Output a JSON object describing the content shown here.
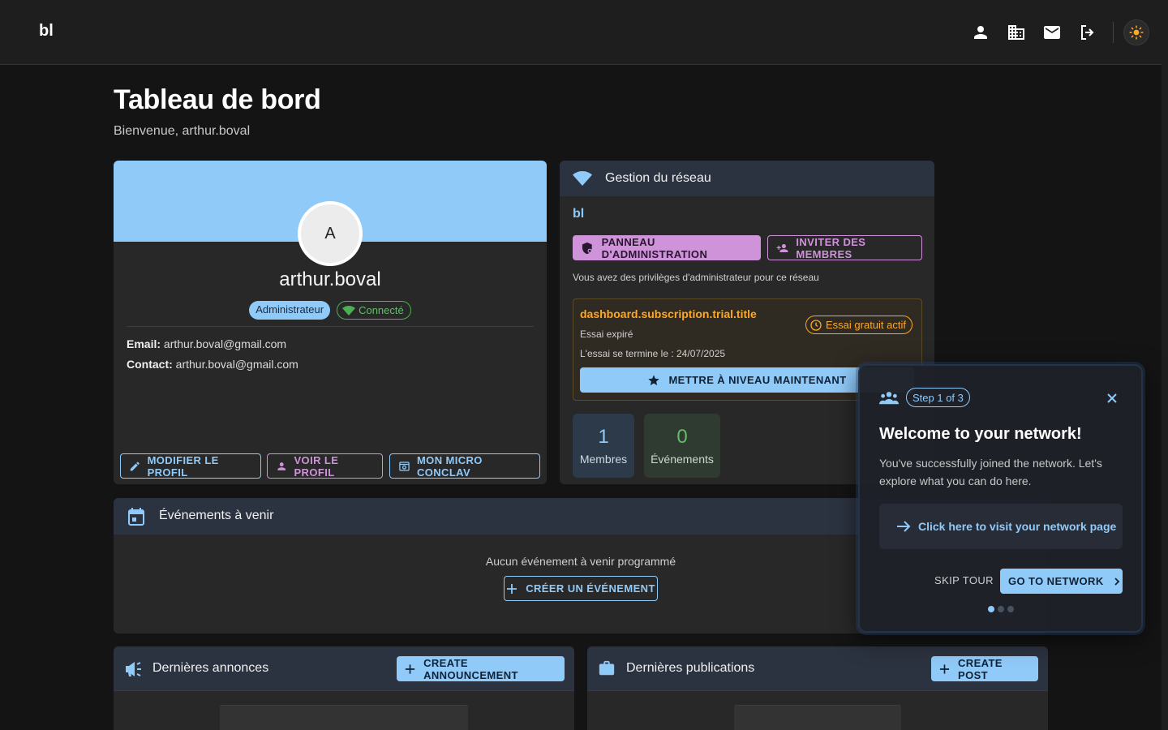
{
  "app": {
    "brand": "bl"
  },
  "topbar": {
    "icons": [
      "person-icon",
      "business-icon",
      "mail-icon",
      "logout-icon"
    ],
    "theme_icon": "sun-icon"
  },
  "header": {
    "title": "Tableau de bord",
    "subtitle": "Bienvenue, arthur.boval"
  },
  "profile": {
    "avatar_letter": "A",
    "name": "arthur.boval",
    "role_badge": "Administrateur",
    "status_badge": "Connecté",
    "email_label": "Email:",
    "email": "arthur.boval@gmail.com",
    "contact_label": "Contact:",
    "contact": "arthur.boval@gmail.com",
    "buttons": {
      "edit": "MODIFIER LE PROFIL",
      "view": "VOIR LE PROFIL",
      "micro": "MON MICRO CONCLAV"
    }
  },
  "network": {
    "header": "Gestion du réseau",
    "name": "bl",
    "admin_button": "PANNEAU D'ADMINISTRATION",
    "invite_button": "INVITER DES MEMBRES",
    "admin_note": "Vous avez des privilèges d'administrateur pour ce réseau",
    "trial": {
      "title": "dashboard.subscription.trial.title",
      "badge": "Essai gratuit actif",
      "status": "Essai expiré",
      "end_text": "L'essai se termine le : 24/07/2025",
      "upgrade_button": "METTRE À NIVEAU MAINTENANT"
    },
    "stats": [
      {
        "value": "1",
        "label": "Membres"
      },
      {
        "value": "0",
        "label": "Événements"
      }
    ]
  },
  "events": {
    "header": "Événements à venir",
    "empty_text": "Aucun événement à venir programmé",
    "create_button": "CRÉER UN ÉVÉNEMENT"
  },
  "announcements": {
    "header": "Dernières annonces",
    "create_button": "CREATE ANNOUNCEMENT"
  },
  "publications": {
    "header": "Dernières publications",
    "create_button": "CREATE POST"
  },
  "tour": {
    "step": "Step 1 of 3",
    "title": "Welcome to your network!",
    "text": "You've successfully joined the network. Let's explore what you can do here.",
    "link": "Click here to visit your network page",
    "skip": "SKIP TOUR",
    "go": "GO TO NETWORK",
    "current_step": 1,
    "total_steps": 3
  },
  "colors": {
    "primary": "#90caf9",
    "secondary": "#ce93d8",
    "warning": "#ffa726",
    "success": "#66bb6a"
  }
}
